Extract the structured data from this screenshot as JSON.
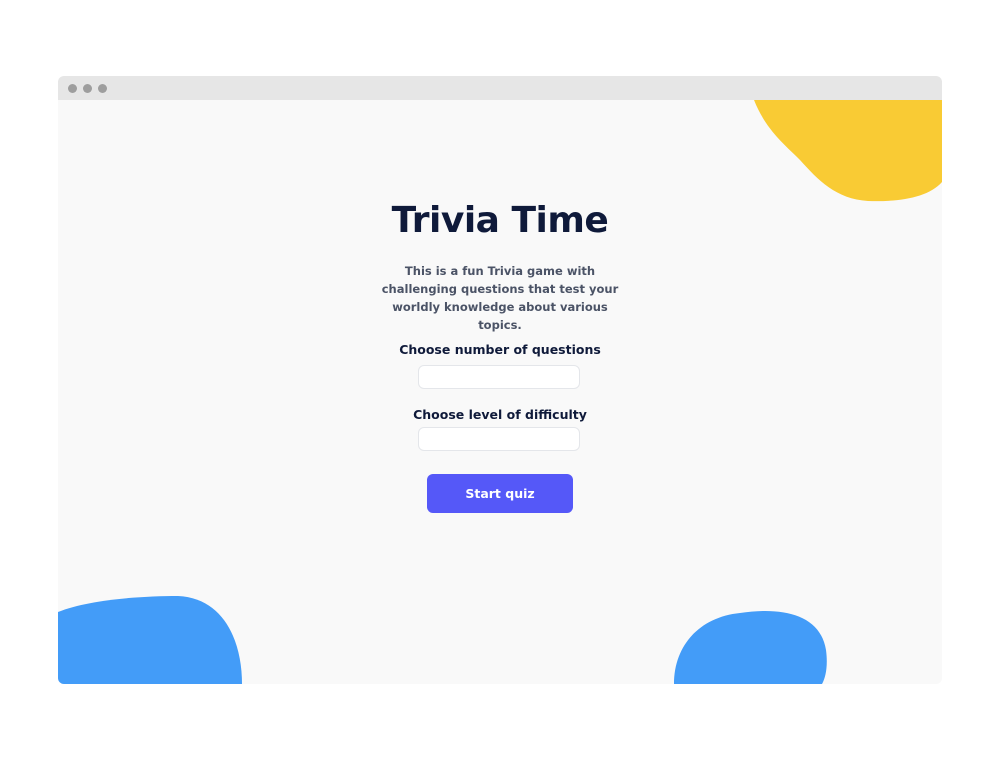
{
  "window": {
    "controls": [
      "window-dot",
      "window-dot",
      "window-dot"
    ]
  },
  "app": {
    "title": "Trivia Time",
    "description": "This is a fun Trivia game with challenging questions that test your worldly knowledge about various topics."
  },
  "form": {
    "questions_label": "Choose number of questions",
    "questions_value": "",
    "difficulty_label": "Choose level of difficulty",
    "difficulty_value": "",
    "start_label": "Start quiz"
  },
  "colors": {
    "accent": "#5558f8",
    "yellow_blob": "#f9cb34",
    "blue_blob": "#439cf8",
    "title": "#0f1a3a"
  }
}
